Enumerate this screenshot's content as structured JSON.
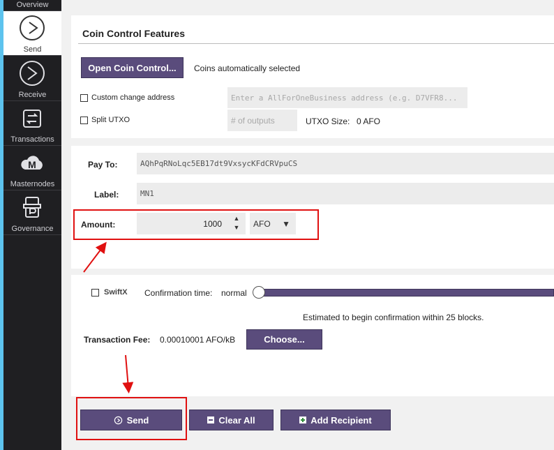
{
  "sidebar": {
    "items": [
      {
        "label": "Overview",
        "icon": "overview-icon",
        "active": false
      },
      {
        "label": "Send",
        "icon": "send-icon",
        "active": true
      },
      {
        "label": "Receive",
        "icon": "receive-icon",
        "active": false
      },
      {
        "label": "Transactions",
        "icon": "transactions-icon",
        "active": false
      },
      {
        "label": "Masternodes",
        "icon": "masternodes-icon",
        "active": false
      },
      {
        "label": "Governance",
        "icon": "governance-icon",
        "active": false
      }
    ]
  },
  "coin_control": {
    "title": "Coin Control Features",
    "open_button": "Open Coin Control...",
    "status": "Coins automatically selected",
    "custom_change_label": "Custom change address",
    "custom_change_placeholder": "Enter a AllForOneBusiness address (e.g. D7VFR8...",
    "split_utxo_label": "Split UTXO",
    "outputs_placeholder": "# of outputs",
    "utxo_size_label": "UTXO Size:",
    "utxo_size_value": "0 AFO"
  },
  "recipient": {
    "pay_to_label": "Pay To:",
    "pay_to_value": "AQhPqRNoLqc5EB17dt9VxsycKFdCRVpuCS",
    "label_label": "Label:",
    "label_value": "MN1",
    "amount_label": "Amount:",
    "amount_value": "1000",
    "unit": "AFO"
  },
  "fee": {
    "swiftx_label": "SwiftX",
    "confirmation_label": "Confirmation time:",
    "confirmation_value": "normal",
    "estimate_text": "Estimated to begin confirmation within 25 blocks.",
    "fee_label": "Transaction Fee:",
    "fee_value": "0.00010001 AFO/kB",
    "choose_button": "Choose..."
  },
  "actions": {
    "send": "Send",
    "clear_all": "Clear All",
    "add_recipient": "Add Recipient"
  },
  "colors": {
    "accent": "#5a4c7c",
    "highlight": "#e01010",
    "sidebar_edge": "#5dc3ee"
  }
}
